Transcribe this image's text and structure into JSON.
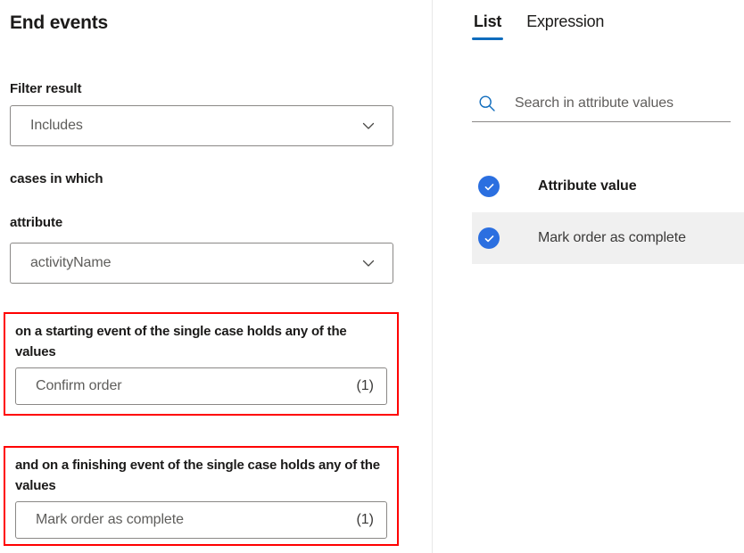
{
  "left": {
    "title": "End events",
    "filter_result_label": "Filter result",
    "filter_result_value": "Includes",
    "cases_in_which_label": "cases in which",
    "attribute_label": "attribute",
    "attribute_value": "activityName",
    "start_group": {
      "label": "on a starting event of the single case holds any of the values",
      "value": "Confirm order",
      "count": "(1)"
    },
    "end_group": {
      "label": "and on a finishing event of the single case holds any of the values",
      "value": "Mark order as complete",
      "count": "(1)"
    }
  },
  "right": {
    "tabs": [
      {
        "label": "List",
        "active": true
      },
      {
        "label": "Expression",
        "active": false
      }
    ],
    "search": {
      "placeholder": "Search in attribute values",
      "value": "",
      "icon": "search-icon"
    },
    "list": {
      "header_label": "Attribute value",
      "rows": [
        {
          "label": "Mark order as complete",
          "checked": true,
          "selected": true
        }
      ]
    }
  },
  "icons": {
    "chevron": "chevron-down-icon",
    "check": "check-icon"
  },
  "colors": {
    "accent": "#0f6cbd",
    "check_blue": "#2b6fe0",
    "highlight_red": "#ff0000",
    "row_selected_bg": "#f0f0f0",
    "border_grey": "#8a8886"
  }
}
